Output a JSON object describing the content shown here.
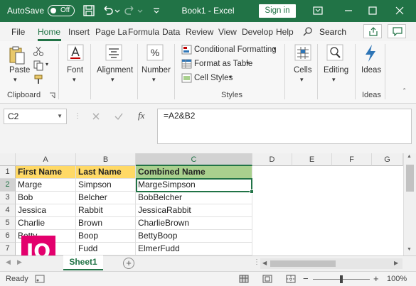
{
  "titlebar": {
    "autosave_label": "AutoSave",
    "autosave_state": "Off",
    "title": "Book1 - Excel",
    "signin_label": "Sign in"
  },
  "tabs": {
    "items": [
      "File",
      "Home",
      "Insert",
      "Page La",
      "Formula",
      "Data",
      "Review",
      "View",
      "Develop",
      "Help"
    ],
    "active": "Home",
    "search_label": "Search"
  },
  "ribbon": {
    "paste_label": "Paste",
    "clipboard_label": "Clipboard",
    "font_label": "Font",
    "alignment_label": "Alignment",
    "number_label": "Number",
    "conditional_formatting_label": "Conditional Formatting",
    "format_as_table_label": "Format as Table",
    "cell_styles_label": "Cell Styles",
    "styles_label": "Styles",
    "cells_label": "Cells",
    "editing_label": "Editing",
    "ideas_label": "Ideas",
    "ideas_group_label": "Ideas"
  },
  "formula_bar": {
    "name_box": "C2",
    "fx_label": "fx",
    "formula": "=A2&B2"
  },
  "grid": {
    "columns": [
      "A",
      "B",
      "C",
      "D",
      "E",
      "F",
      "G"
    ],
    "selected_column": "C",
    "selected_row": "2",
    "rows": [
      {
        "num": "1",
        "cells": [
          "First Name",
          "Last Name",
          "Combined Name"
        ]
      },
      {
        "num": "2",
        "cells": [
          "Marge",
          "Simpson",
          "MargeSimpson"
        ]
      },
      {
        "num": "3",
        "cells": [
          "Bob",
          "Belcher",
          "BobBelcher"
        ]
      },
      {
        "num": "4",
        "cells": [
          "Jessica",
          "Rabbit",
          "JessicaRabbit"
        ]
      },
      {
        "num": "5",
        "cells": [
          "Charlie",
          "Brown",
          "CharlieBrown"
        ]
      },
      {
        "num": "6",
        "cells": [
          "Betty",
          "Boop",
          "BettyBoop"
        ]
      },
      {
        "num": "7",
        "cells": [
          "",
          "Fudd",
          "ElmerFudd"
        ]
      }
    ],
    "header_colors": {
      "first_name": "#ffd966",
      "last_name": "#ffd966",
      "combined_name": "#a9d08e"
    }
  },
  "sheets": {
    "active_sheet": "Sheet1"
  },
  "status": {
    "ready": "Ready",
    "zoom": "100%"
  },
  "watermark": {
    "text": "IO"
  },
  "colors": {
    "accent": "#217346",
    "watermark": "#e3006d"
  }
}
